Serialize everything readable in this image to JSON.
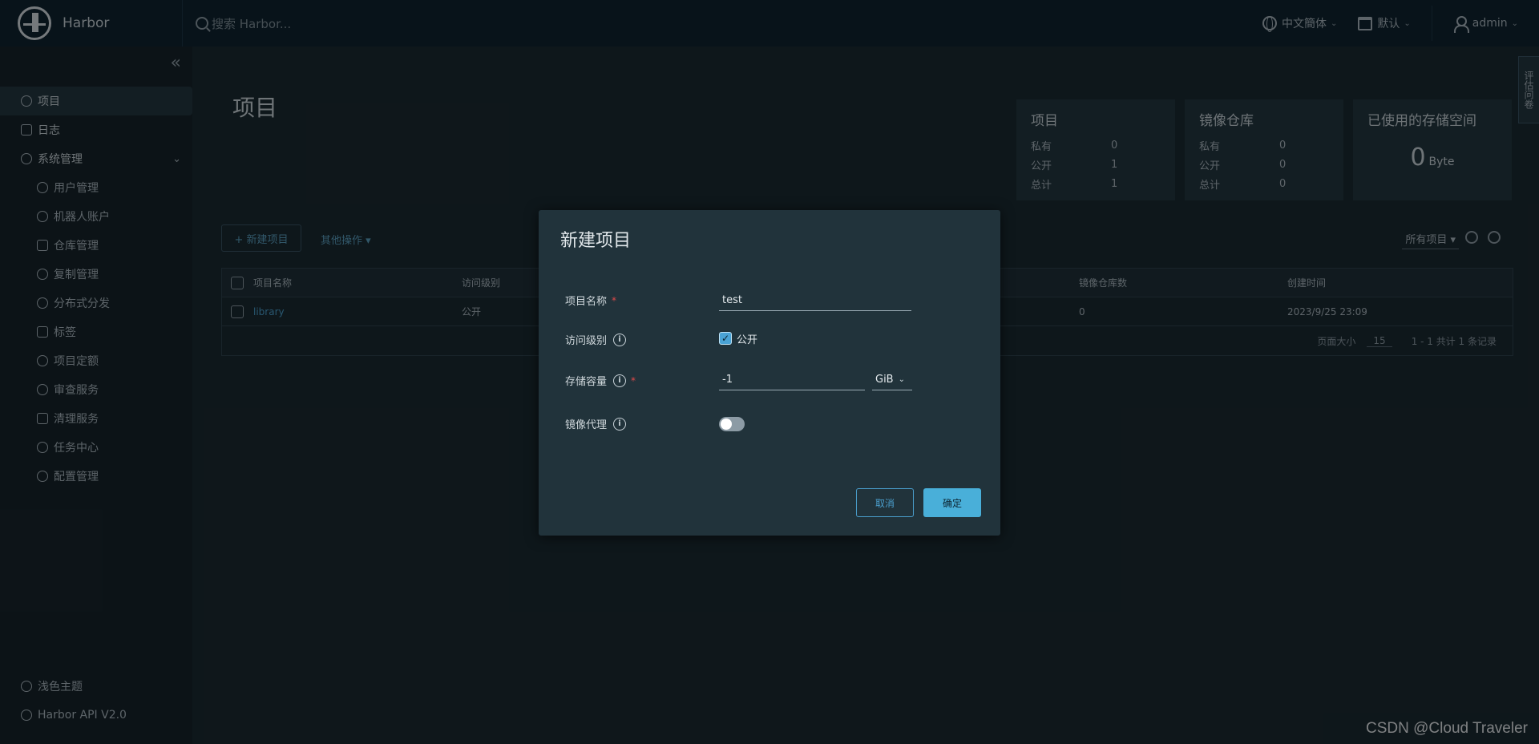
{
  "header": {
    "brand": "Harbor",
    "search_placeholder": "搜索 Harbor...",
    "language": "中文簡体",
    "datetime_format": "默认",
    "user": "admin"
  },
  "sidebar": {
    "items": [
      {
        "label": "项目",
        "icon": "project-icon"
      },
      {
        "label": "日志",
        "icon": "log-icon"
      },
      {
        "label": "系统管理",
        "icon": "admin-icon"
      }
    ],
    "sub_items": [
      {
        "label": "用户管理",
        "icon": "users-icon"
      },
      {
        "label": "机器人账户",
        "icon": "robot-icon"
      },
      {
        "label": "仓库管理",
        "icon": "registry-icon"
      },
      {
        "label": "复制管理",
        "icon": "replication-icon"
      },
      {
        "label": "分布式分发",
        "icon": "distribution-icon"
      },
      {
        "label": "标签",
        "icon": "tag-icon"
      },
      {
        "label": "项目定额",
        "icon": "quota-icon"
      },
      {
        "label": "审查服务",
        "icon": "shield-icon"
      },
      {
        "label": "清理服务",
        "icon": "trash-icon"
      },
      {
        "label": "任务中心",
        "icon": "job-icon"
      },
      {
        "label": "配置管理",
        "icon": "gear-icon"
      }
    ],
    "theme": "浅色主题",
    "api": "Harbor API V2.0"
  },
  "main": {
    "title": "项目",
    "cards": {
      "projects": {
        "title": "项目",
        "rows": [
          {
            "k": "私有",
            "v": "0"
          },
          {
            "k": "公开",
            "v": "1"
          },
          {
            "k": "总计",
            "v": "1"
          }
        ]
      },
      "repos": {
        "title": "镜像仓库",
        "rows": [
          {
            "k": "私有",
            "v": "0"
          },
          {
            "k": "公开",
            "v": "0"
          },
          {
            "k": "总计",
            "v": "0"
          }
        ]
      },
      "storage": {
        "title": "已使用的存储空间",
        "value": "0",
        "unit": "Byte"
      }
    },
    "new_project_btn": "+ 新建项目",
    "more_actions": "其他操作 ▾",
    "filter": "所有项目 ▾",
    "grid": {
      "columns": [
        "项目名称",
        "访问级别",
        "镜像仓库数",
        "创建时间"
      ],
      "rows": [
        {
          "name": "library",
          "access": "公开",
          "repos": "0",
          "created": "2023/9/25 23:09"
        }
      ],
      "page_size_label": "页面大小",
      "page_size": "15",
      "summary": "1 - 1 共计 1 条记录"
    }
  },
  "side_tab": "评估问卷",
  "modal": {
    "title": "新建项目",
    "name_label": "项目名称",
    "name_value": "test",
    "access_label": "访问级别",
    "public_label": "公开",
    "storage_label": "存储容量",
    "storage_value": "-1",
    "storage_unit": "GiB",
    "proxy_label": "镜像代理",
    "cancel": "取消",
    "ok": "确定"
  },
  "watermark": "CSDN @Cloud Traveler"
}
